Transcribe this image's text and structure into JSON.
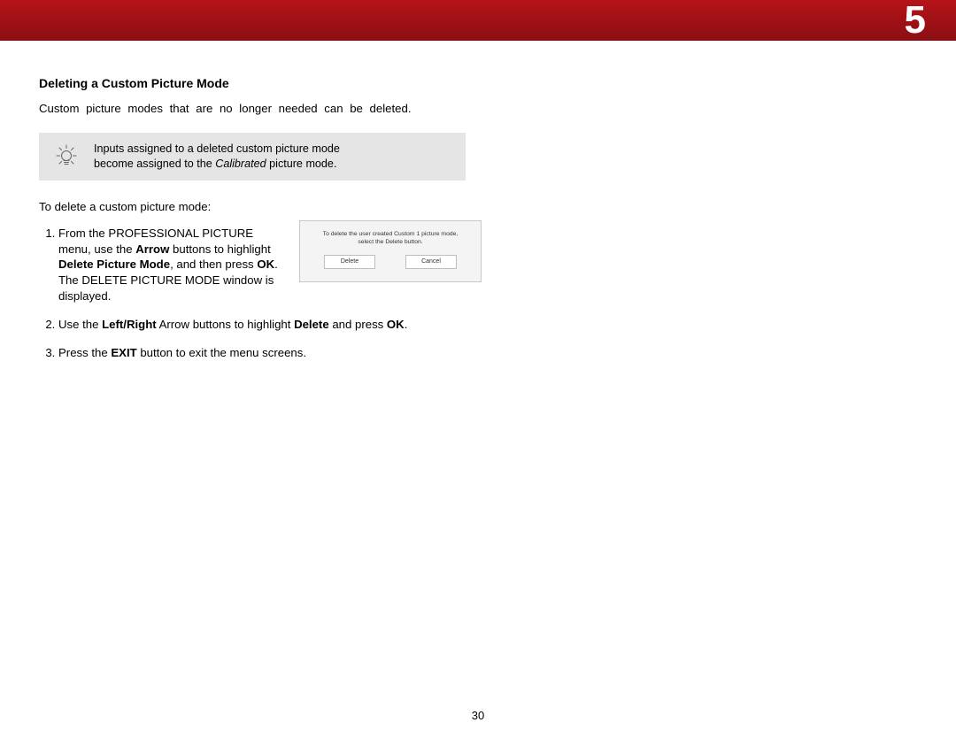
{
  "chapter_number": "5",
  "section_title": "Deleting a Custom Picture Mode",
  "intro_text": "Custom picture modes that are no longer needed can be deleted.",
  "tip": {
    "line1": "Inputs assigned to a deleted custom picture mode",
    "line2_pre": "become assigned to the ",
    "line2_ital": "Calibrated",
    "line2_post": " picture mode."
  },
  "lead_in": "To delete a custom picture mode:",
  "steps": {
    "s1": {
      "t1": "From the PROFESSIONAL PICTURE menu, use the ",
      "b1": "Arrow",
      "t2": " buttons to highlight ",
      "b2": "Delete Picture Mode",
      "t3": ", and then press ",
      "b3": "OK",
      "t4": ". The DELETE PICTURE MODE window is displayed."
    },
    "s2": {
      "t1": "Use the ",
      "b1": "Left/Right",
      "t2": " Arrow buttons to highlight ",
      "b2": "Delete",
      "t3": " and press ",
      "b3": "OK",
      "t4": "."
    },
    "s3": {
      "t1": "Press the ",
      "b1": "EXIT",
      "t2": " button to exit the menu screens."
    }
  },
  "dialog": {
    "msg_l1": "To delete the user created Custom 1 picture mode,",
    "msg_l2": "select the Delete button.",
    "btn_delete": "Delete",
    "btn_cancel": "Cancel"
  },
  "page_number": "30"
}
